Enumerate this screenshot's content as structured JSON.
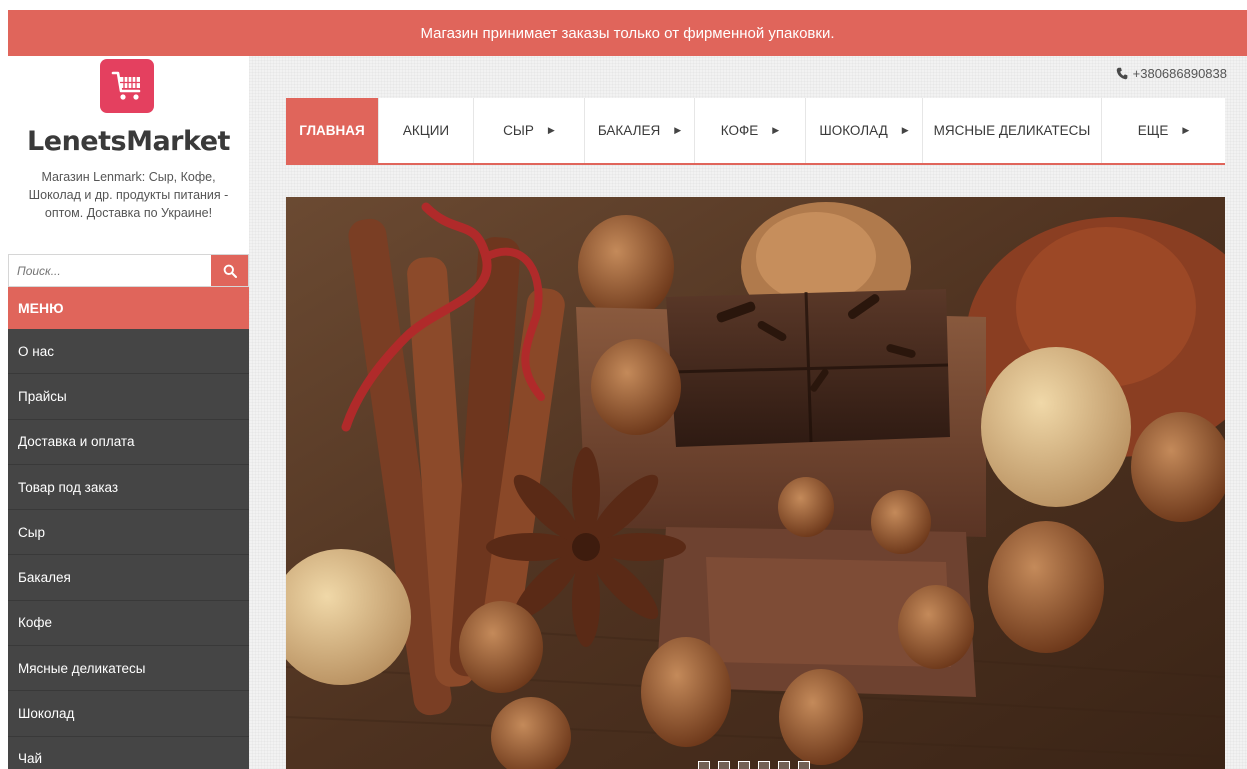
{
  "banner": {
    "text": "Магазин принимает заказы только от фирменной упаковки."
  },
  "logo": {
    "name": "LenetsMarket",
    "description": "Магазин Lenmark: Сыр, Кофе, Шоколад и др. продукты питания - оптом. Доставка по Украине!"
  },
  "search": {
    "placeholder": "Поиск..."
  },
  "menu": {
    "header": "МЕНЮ",
    "items": [
      {
        "label": "О нас"
      },
      {
        "label": "Прайсы"
      },
      {
        "label": "Доставка и оплата"
      },
      {
        "label": "Товар под заказ"
      },
      {
        "label": "Сыр"
      },
      {
        "label": "Бакалея"
      },
      {
        "label": "Кофе"
      },
      {
        "label": "Мясные деликатесы"
      },
      {
        "label": "Шоколад"
      },
      {
        "label": "Чай"
      }
    ]
  },
  "header": {
    "phone": "+380686890838"
  },
  "nav": {
    "items": [
      {
        "label": "ГЛАВНАЯ",
        "active": true,
        "dropdown": false
      },
      {
        "label": "АКЦИИ",
        "active": false,
        "dropdown": false
      },
      {
        "label": "СЫР",
        "active": false,
        "dropdown": true
      },
      {
        "label": "БАКАЛЕЯ",
        "active": false,
        "dropdown": true
      },
      {
        "label": "КОФЕ",
        "active": false,
        "dropdown": true
      },
      {
        "label": "ШОКОЛАД",
        "active": false,
        "dropdown": true
      },
      {
        "label": "МЯСНЫЕ ДЕЛИКАТЕСЫ",
        "active": false,
        "dropdown": false
      },
      {
        "label": "ЕЩЕ",
        "active": false,
        "dropdown": true
      }
    ]
  },
  "slider": {
    "slide_count": 6,
    "active_slide": 1
  },
  "colors": {
    "accent": "#e0655b",
    "menu_bg": "#454545",
    "logo_badge": "#e4405f"
  },
  "icons": [
    "cart-icon",
    "search-icon",
    "phone-icon",
    "chevron-right-icon"
  ]
}
